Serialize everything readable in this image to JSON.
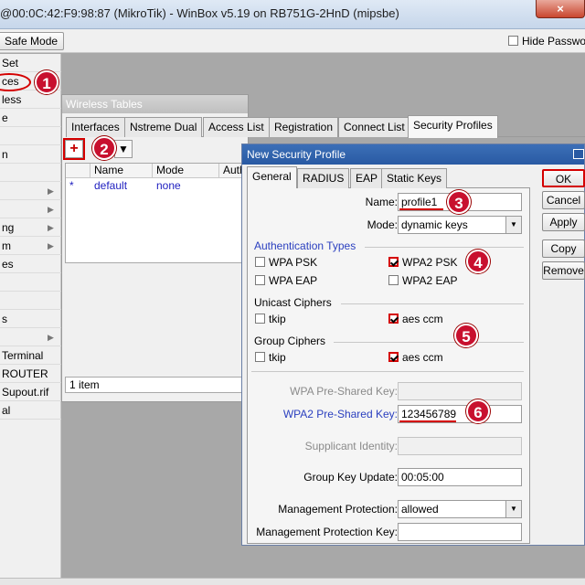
{
  "window": {
    "title": "@00:0C:42:F9:98:87 (MikroTik) - WinBox v5.19 on RB751G-2HnD (mipsbe)",
    "close_glyph": "×"
  },
  "toolbar": {
    "safe_mode": "Safe Mode",
    "hide_passwords": "Hide Passwo"
  },
  "sidebar": {
    "items": [
      {
        "label": "Set",
        "arrow": false
      },
      {
        "label": "ces",
        "arrow": false
      },
      {
        "label": "less",
        "arrow": false
      },
      {
        "label": "e",
        "arrow": false
      },
      {
        "label": "",
        "arrow": false
      },
      {
        "label": "n",
        "arrow": false
      },
      {
        "label": "",
        "arrow": false
      },
      {
        "label": "",
        "arrow": true
      },
      {
        "label": "",
        "arrow": true
      },
      {
        "label": "ng",
        "arrow": true
      },
      {
        "label": "m",
        "arrow": true
      },
      {
        "label": "es",
        "arrow": false
      },
      {
        "label": "",
        "arrow": false
      },
      {
        "label": "",
        "arrow": false
      },
      {
        "label": "s",
        "arrow": false
      },
      {
        "label": "",
        "arrow": true
      },
      {
        "label": "Terminal",
        "arrow": false
      },
      {
        "label": "ROUTER",
        "arrow": false
      },
      {
        "label": "Supout.rif",
        "arrow": false
      },
      {
        "label": "al",
        "arrow": false
      }
    ]
  },
  "wireless_tables": {
    "title": "Wireless Tables",
    "tabs": [
      "Interfaces",
      "Nstreme Dual",
      "Access List",
      "Registration",
      "Connect List",
      "Security Profiles"
    ],
    "columns": [
      "Name",
      "Mode",
      "Auth"
    ],
    "rows": [
      {
        "marker": "*",
        "name": "default",
        "mode": "none"
      }
    ],
    "footer": "1 item",
    "add_glyph": "+",
    "filter_glyph": "▼"
  },
  "dialog": {
    "title": "New Security Profile",
    "tabs": [
      "General",
      "RADIUS",
      "EAP",
      "Static Keys"
    ],
    "name_label": "Name:",
    "name_value": "profile1",
    "mode_label": "Mode:",
    "mode_value": "dynamic keys",
    "auth_types_label": "Authentication Types",
    "wpa_psk": "WPA PSK",
    "wpa2_psk": "WPA2 PSK",
    "wpa_eap": "WPA EAP",
    "wpa2_eap": "WPA2 EAP",
    "unicast_label": "Unicast Ciphers",
    "group_label": "Group Ciphers",
    "tkip": "tkip",
    "aes_ccm": "aes ccm",
    "wpa_key_label": "WPA Pre-Shared Key:",
    "wpa2_key_label": "WPA2 Pre-Shared Key:",
    "wpa2_key_value": "123456789",
    "supplicant_label": "Supplicant Identity:",
    "group_update_label": "Group Key Update:",
    "group_update_value": "00:05:00",
    "mgmt_prot_label": "Management Protection:",
    "mgmt_prot_value": "allowed",
    "mgmt_key_label": "Management Protection Key:",
    "buttons": {
      "ok": "OK",
      "cancel": "Cancel",
      "apply": "Apply",
      "copy": "Copy",
      "remove": "Remove"
    }
  },
  "badges": [
    "1",
    "2",
    "3",
    "4",
    "5",
    "6"
  ],
  "colors": {
    "highlight": "#d40000",
    "badge": "#c8102e",
    "dialog_title": "#295aa3",
    "link": "#2020c0"
  }
}
